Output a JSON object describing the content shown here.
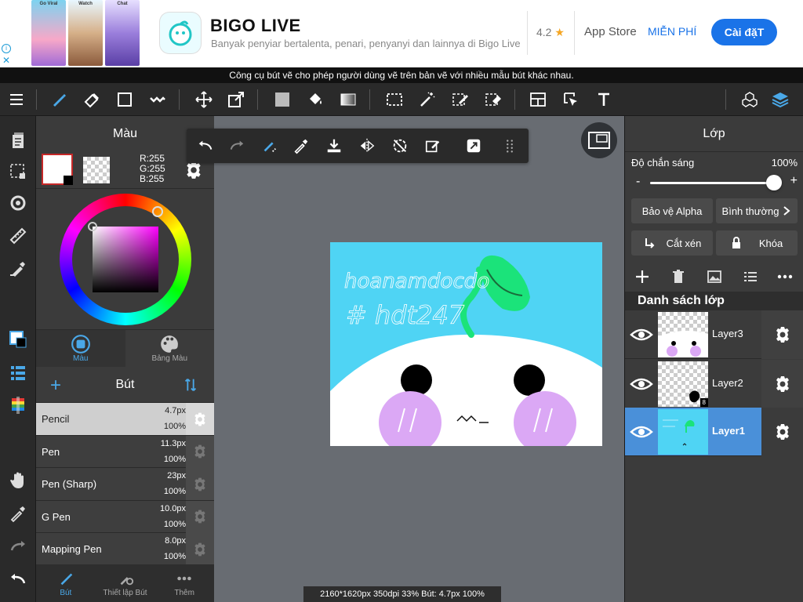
{
  "ad": {
    "shot_labels": [
      "Go Viral",
      "Watch",
      "Chat"
    ],
    "title": "BIGO LIVE",
    "subtitle": "Banyak penyiar bertalenta, penari, penyanyi dan lainnya di Bigo Live",
    "rating": "4.2",
    "rating_star": "★",
    "store": "App Store",
    "price": "MIỄN PHÍ",
    "install": "Cài đặT",
    "info_glyph": "i",
    "close_glyph": "✕"
  },
  "tooltip": "Công cụ bút vẽ cho phép người dùng vẽ trên bản vẽ với nhiều mẫu bút khác nhau.",
  "color_panel": {
    "title": "Màu",
    "rgb": [
      "R:255",
      "G:255",
      "B:255"
    ],
    "tabs": [
      {
        "label": "Màu",
        "icon": "color-wheel-icon"
      },
      {
        "label": "Bảng Màu",
        "icon": "palette-icon"
      }
    ]
  },
  "brush_panel": {
    "title": "Bút",
    "brushes": [
      {
        "name": "Pencil",
        "size": "4.7px",
        "opacity": "100%",
        "selected": true
      },
      {
        "name": "Pen",
        "size": "11.3px",
        "opacity": "100%"
      },
      {
        "name": "Pen (Sharp)",
        "size": "23px",
        "opacity": "100%"
      },
      {
        "name": "G Pen",
        "size": "10.0px",
        "opacity": "100%"
      },
      {
        "name": "Mapping Pen",
        "size": "8.0px",
        "opacity": "100%"
      }
    ],
    "footer": [
      {
        "label": "Bút",
        "icon": "brush-icon"
      },
      {
        "label": "Thiết lập Bút",
        "icon": "brush-settings-icon"
      },
      {
        "label": "Thêm",
        "icon": "more-icon"
      }
    ]
  },
  "canvas": {
    "status": "2160*1620px 350dpi 33% Bút: 4.7px 100%",
    "art_text_1": "hoanamdocdo",
    "art_text_2": "# hdt247"
  },
  "layer_panel": {
    "title": "Lớp",
    "opacity_label": "Độ chắn sáng",
    "opacity_value": "100%",
    "opacity_fraction": 1.0,
    "slider_minus": "-",
    "slider_plus": "+",
    "alpha_protect": "Bảo vệ Alpha",
    "blend_mode": "Bình thường",
    "clipping": "Cắt xén",
    "lock": "Khóa",
    "list_title": "Danh sách lớp",
    "layers": [
      {
        "name": "Layer3",
        "selected": false
      },
      {
        "name": "Layer2",
        "selected": false,
        "badge": "8"
      },
      {
        "name": "Layer1",
        "selected": true
      }
    ]
  },
  "colors": {
    "accent": "#4aa8e8",
    "selected_layer": "#4a90d9",
    "canvas_bg": "#4fd4f4"
  }
}
